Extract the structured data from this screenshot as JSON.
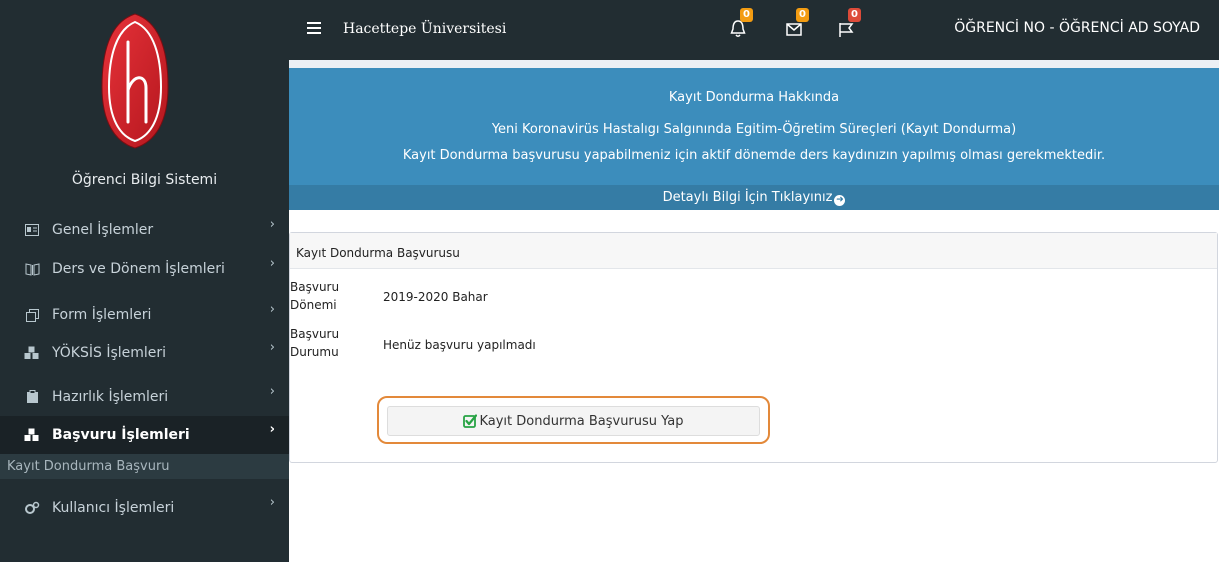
{
  "header": {
    "university": "Hacettepe Üniversitesi",
    "user": "ÖĞRENCİ NO - ÖĞRENCİ AD SOYAD",
    "notifications": [
      {
        "icon": "bell-icon",
        "count": "0",
        "color": "#f39c12"
      },
      {
        "icon": "envelope-icon",
        "count": "0",
        "color": "#f39c12"
      },
      {
        "icon": "flag-icon",
        "count": "0",
        "color": "#dd4b39"
      }
    ]
  },
  "sidebar": {
    "app_name": "Öğrenci Bilgi Sistemi",
    "items": [
      {
        "label": "Genel İşlemler",
        "icon": "id-card-icon"
      },
      {
        "label": "Ders ve Dönem İşlemleri",
        "icon": "book-icon"
      },
      {
        "label": "Form İşlemleri",
        "icon": "form-icon"
      },
      {
        "label": "YÖKSİS İşlemleri",
        "icon": "cubes-icon"
      },
      {
        "label": "Hazırlık İşlemleri",
        "icon": "clipboard-icon"
      },
      {
        "label": "Başvuru İşlemleri",
        "icon": "cubes-icon",
        "active": true
      },
      {
        "label": "Kullanıcı İşlemleri",
        "icon": "cogs-icon"
      }
    ],
    "subitem": "Kayıt Dondurma Başvuru"
  },
  "info": {
    "title": "Kayıt Dondurma Hakkında",
    "line1": "Yeni Koronavirüs Hastalıgı Salgınında Egitim-Öğretim Süreçleri (Kayıt Dondurma)",
    "line2": "Kayıt Dondurma başvurusu yapabilmeniz için aktif dönemde ders kaydınızın yapılmış olması gerekmektedir.",
    "footer": "Detaylı Bilgi İçin Tıklayınız"
  },
  "form": {
    "title": "Kayıt Dondurma Başvurusu",
    "period_label": "Başvuru Dönemi",
    "period_value": "2019-2020 Bahar",
    "status_label": "Başvuru Durumu",
    "status_value": "Henüz başvuru yapılmadı",
    "apply_button": "Kayıt Dondurma Başvurusu Yap"
  },
  "colors": {
    "sidebar_bg": "#222d32",
    "info_bg": "#3c8dbc",
    "highlight_ring": "#e3893a",
    "check_green": "#27a344"
  }
}
